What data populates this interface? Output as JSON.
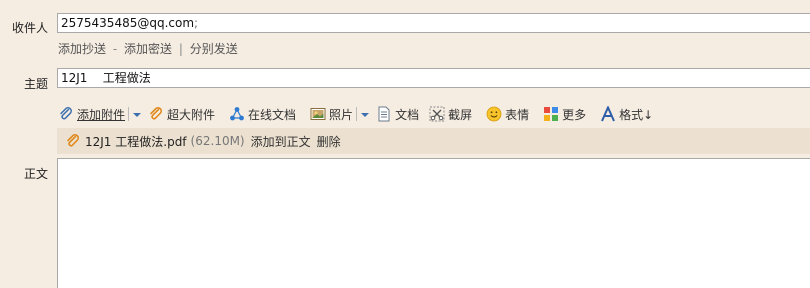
{
  "to": {
    "label": "收件人",
    "value": "2575435485@qq.com",
    "separator": ";"
  },
  "recipient_links": {
    "cc": "添加抄送",
    "dash": "-",
    "bcc": "添加密送",
    "pipe": "|",
    "separate": "分别发送"
  },
  "subject": {
    "label": "主题",
    "value": "12J1    工程做法"
  },
  "toolbar": {
    "add_attachment": "添加附件",
    "large_attachment": "超大附件",
    "online_doc": "在线文档",
    "photo": "照片",
    "document": "文档",
    "screenshot": "截屏",
    "emoji": "表情",
    "more": "更多",
    "format": "格式↓"
  },
  "attachment": {
    "filename": "12J1 工程做法.pdf",
    "size": "(62.10M)",
    "insert_label": "添加到正文",
    "delete_label": "删除"
  },
  "body": {
    "label": "正文"
  },
  "colors": {
    "background": "#f5ede2",
    "attachment_bar": "#ece1d0",
    "field_border": "#a9a9a9"
  }
}
